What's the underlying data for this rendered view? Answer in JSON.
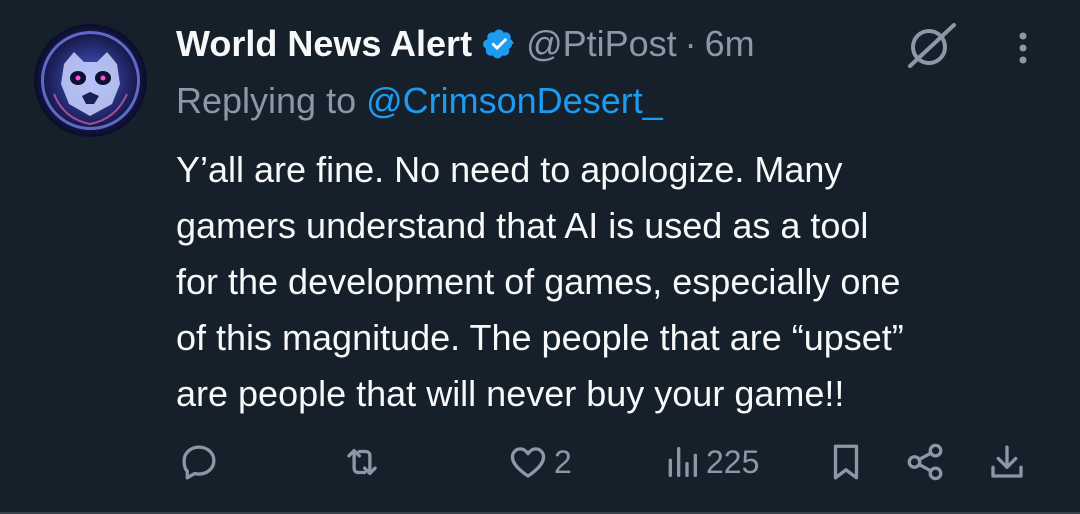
{
  "author": {
    "display_name": "World News Alert",
    "handle": "@PtiPost",
    "separator": "·",
    "time": "6m",
    "verified": true
  },
  "reply": {
    "prefix": "Replying to ",
    "target": "@CrimsonDesert_"
  },
  "body": {
    "lines": [
      "Y’all are fine. No need to apologize. Many",
      "gamers understand that AI is used as a tool",
      "for the development of games, especially one",
      "of this magnitude. The people that are “upset”",
      "are people that will never buy your game!!"
    ]
  },
  "actions": {
    "likes": "2",
    "views": "225"
  },
  "icons": {
    "verified": "verified-badge-icon",
    "grok": "grok-icon",
    "more": "more-vertical-icon",
    "reply": "reply-icon",
    "retweet": "retweet-icon",
    "like": "heart-icon",
    "views": "views-icon",
    "bookmark": "bookmark-icon",
    "share": "share-icon",
    "download": "download-icon"
  },
  "colors": {
    "background": "#15202b",
    "text": "#f7f9f9",
    "muted": "#8b98a5",
    "accent": "#1d9bf0"
  }
}
